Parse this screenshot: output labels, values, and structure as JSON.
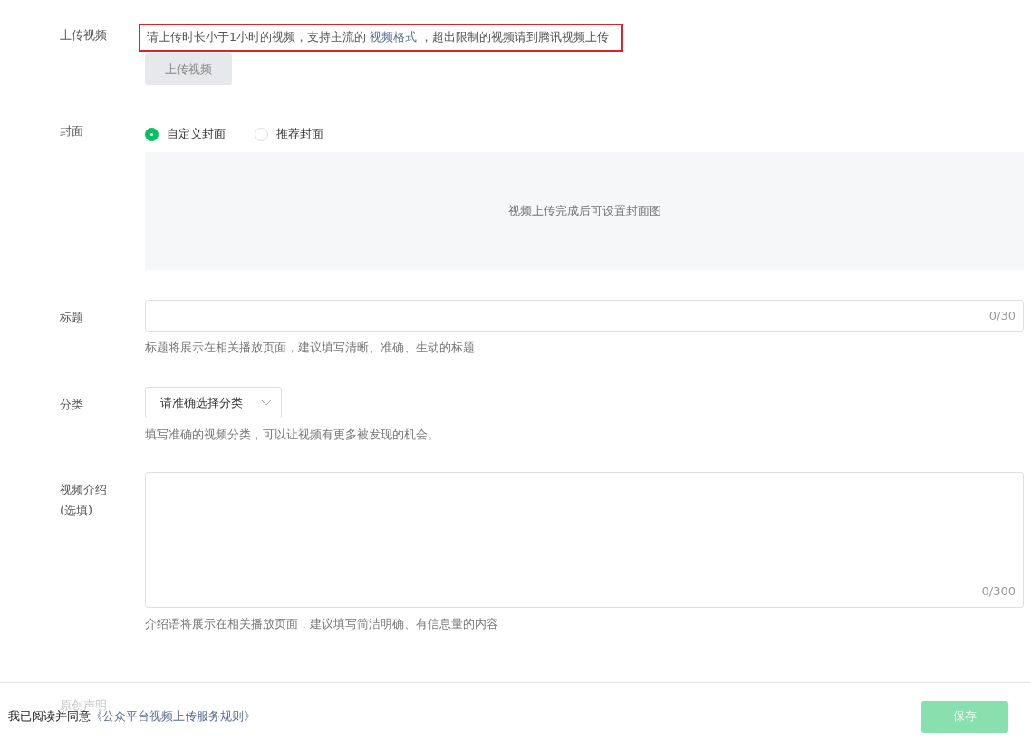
{
  "upload": {
    "label": "上传视频",
    "hint_parts": [
      "请上传时长小于1小时的视频，支持主流的",
      "视频格式",
      "，超出限制的视频请到腾讯视频上传"
    ],
    "button": "上传视频",
    "highlighted": true
  },
  "cover": {
    "label": "封面",
    "options": [
      {
        "label": "自定义封面",
        "selected": true
      },
      {
        "label": "推荐封面",
        "selected": false
      }
    ],
    "placeholder_text": "视频上传完成后可设置封面图"
  },
  "title": {
    "label": "标题",
    "counter": "0/30",
    "help": "标题将展示在相关播放页面，建议填写清晰、准确、生动的标题"
  },
  "category": {
    "label": "分类",
    "placeholder": "请准确选择分类",
    "help": "填写准确的视频分类，可以让视频有更多被发现的机会。"
  },
  "intro": {
    "label_lines": [
      "视频介绍",
      "(选填)"
    ],
    "counter": "0/300",
    "help": "介绍语将展示在相关播放页面，建议填写简洁明确、有信息量的内容"
  },
  "original": {
    "label": "原创声明"
  },
  "footer": {
    "agree_text": "我已阅读并同意",
    "agree_link": "《公众平台视频上传服务规则》",
    "save_button": "保存",
    "save_disabled": true
  }
}
